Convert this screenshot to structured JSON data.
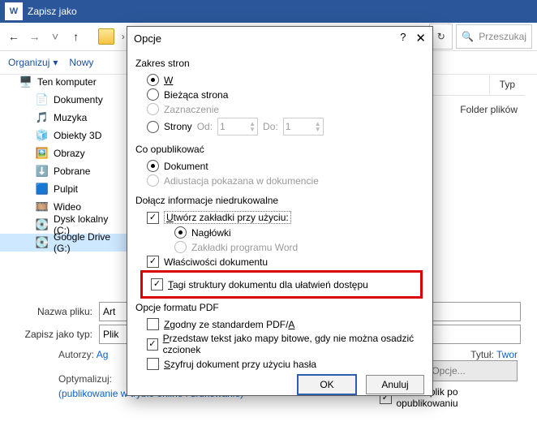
{
  "titlebar": {
    "title": "Zapisz jako"
  },
  "toolbar": {
    "organize": "Organizuj",
    "new": "Nowy"
  },
  "pathbar": {
    "searchPlaceholder": "Przeszukaj"
  },
  "tree": {
    "items": [
      {
        "label": "Ten komputer",
        "kind": "pc"
      },
      {
        "label": "Dokumenty",
        "kind": "doc"
      },
      {
        "label": "Muzyka",
        "kind": "music"
      },
      {
        "label": "Obiekty 3D",
        "kind": "3d"
      },
      {
        "label": "Obrazy",
        "kind": "img"
      },
      {
        "label": "Pobrane",
        "kind": "dl"
      },
      {
        "label": "Pulpit",
        "kind": "desk"
      },
      {
        "label": "Wideo",
        "kind": "vid"
      },
      {
        "label": "Dysk lokalny (C:)",
        "kind": "hd"
      },
      {
        "label": "Google Drive (G:)",
        "kind": "hd",
        "sel": true
      }
    ]
  },
  "filehead": {
    "type": "Typ"
  },
  "empty": "Folder plików",
  "form": {
    "nameLabel": "Nazwa pliku:",
    "nameVal": "Art",
    "typeLabel": "Zapisz jako typ:",
    "typeVal": "Plik",
    "authorsLabel": "Autorzy:",
    "authorsVal": "Ag",
    "optimizeLabel": "Optymalizuj:",
    "optA": "(publikowanie w trybie online i drukowanie)",
    "titleLabel": "Tytuł:",
    "titleVal": "Twor"
  },
  "bottom": {
    "optionsBtn": "Opcje...",
    "openAfter": "Otwórz plik po opublikowaniu"
  },
  "dialog": {
    "title": "Opcje",
    "pageRange": "Zakres stron",
    "all": "Wszystko",
    "current": "Bieżąca strona",
    "selection": "Zaznaczenie",
    "pages": "Strony",
    "from": "Od:",
    "fromVal": "1",
    "to": "Do:",
    "toVal": "1",
    "publishWhat": "Co opublikować",
    "document": "Dokument",
    "markup": "Adiustacja pokazana w dokumencie",
    "nonprint": "Dołącz informacje niedrukowalne",
    "bookmarks": "Utwórz zakładki przy użyciu:",
    "headings": "Nagłówki",
    "wordBookmarks": "Zakładki programu Word",
    "docProps": "Właściwości dokumentu",
    "tags": "Tagi struktury dokumentu dla ułatwień dostępu",
    "pdfOpts": "Opcje formatu PDF",
    "pdfa": "Zgodny ze standardem PDF/A",
    "bitmap": "Przedstaw tekst jako mapy bitowe, gdy nie można osadzić czcionek",
    "encrypt": "Szyfruj dokument przy użyciu hasła",
    "ok": "OK",
    "cancel": "Anuluj"
  }
}
